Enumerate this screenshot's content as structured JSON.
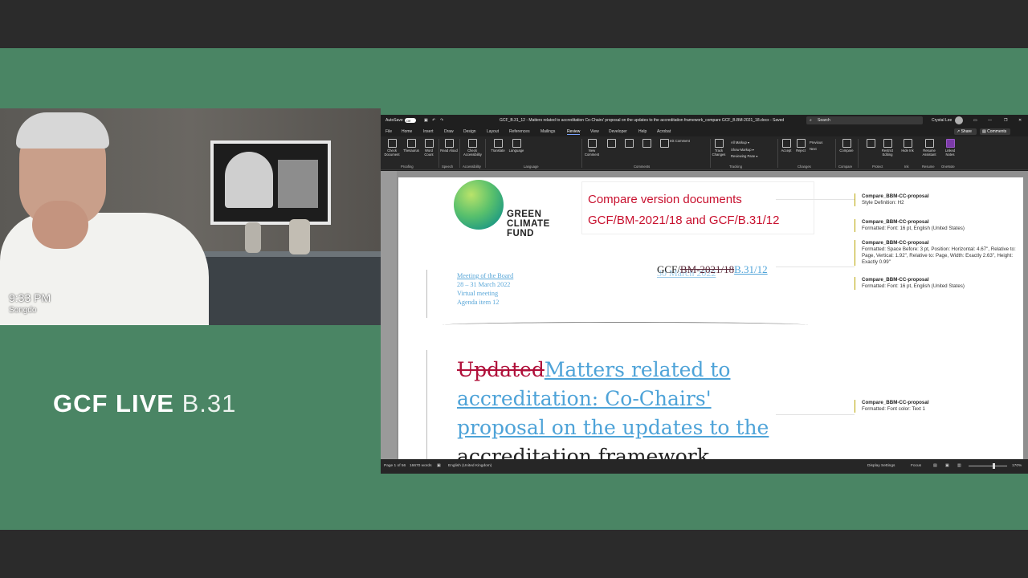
{
  "stream": {
    "time": "9:33 PM",
    "location": "Songdo",
    "brand_strong": "GCF LIVE",
    "brand_light": "B.31"
  },
  "word": {
    "autosave_label": "AutoSave",
    "autosave_state": "Off",
    "doc_title": "GCF_B.31_12 - Matters related to accreditation Co-Chairs' proposal on the updates to the accreditation framework_compare GCF_B.BM-2021_18.docx - Saved",
    "search_placeholder": "Search",
    "user_name": "Crystal Lee",
    "tabs": [
      "File",
      "Home",
      "Insert",
      "Draw",
      "Design",
      "Layout",
      "References",
      "Mailings",
      "Review",
      "View",
      "Developer",
      "Help",
      "Acrobat"
    ],
    "active_tab": "Review",
    "share_label": "Share",
    "comments_label": "Comments",
    "ribbon": {
      "check_document": "Check Document",
      "thesaurus": "Thesaurus",
      "word_count": "Word Count",
      "read_aloud": "Read Aloud",
      "check_accessibility": "Check Accessibility",
      "translate": "Translate",
      "language": "Language",
      "new_comment": "New Comment",
      "ink_comment": "Ink Comment",
      "track_changes": "Track Changes",
      "markup_select": "All Markup",
      "show_markup": "Show Markup",
      "reviewing_pane": "Reviewing Pane",
      "accept": "Accept",
      "reject": "Reject",
      "previous": "Previous",
      "next": "Next",
      "compare": "Compare",
      "restrict_editing": "Restrict Editing",
      "hide_ink": "Hide Ink",
      "resume_assistant": "Resume Assistant",
      "linked_notes": "Linked Notes",
      "groups": [
        "Proofing",
        "Speech",
        "Accessibility",
        "Language",
        "Comments",
        "Tracking",
        "Changes",
        "Compare",
        "Protect",
        "Ink",
        "Resume",
        "OneNote"
      ]
    },
    "status": {
      "page": "Page 1 of 56",
      "words": "16670 words",
      "language": "English (United Kingdom)",
      "display_settings": "Display Settings",
      "focus": "Focus",
      "zoom": "170%"
    },
    "document": {
      "logo_lines": [
        "GREEN",
        "CLIMATE",
        "FUND"
      ],
      "compare_line1": "Compare version documents",
      "compare_line2": "GCF/BM-2021/18 and GCF/B.31/12",
      "meeting_line1": "Meeting of the Board",
      "meeting_line2": "28 – 31 March 2022",
      "meeting_line3": "Virtual meeting",
      "meeting_line4": "Agenda item 12",
      "doc_prefix": "GCF/",
      "doc_deleted": "BM-2021/18",
      "doc_inserted": "B.31/12",
      "doc_underlay": "30 March 2022",
      "title_deleted": "Updated",
      "title_inserted": "Matters related to accreditation: Co-Chairs' proposal on the updates to the",
      "title_cut": "accreditation framework"
    },
    "balloons": [
      {
        "author": "Compare_BBM-CC-proposal",
        "text": "Style Definition: H2"
      },
      {
        "author": "Compare_BBM-CC-proposal",
        "text": "Formatted: Font: 16 pt, English (United States)"
      },
      {
        "author": "Compare_BBM-CC-proposal",
        "text": "Formatted: Space Before: 3 pt, Position: Horizontal: 4.67\", Relative to: Page, Vertical: 1.92\", Relative to: Page, Width: Exactly 2.63\", Height: Exactly 0.99\""
      },
      {
        "author": "Compare_BBM-CC-proposal",
        "text": "Formatted: Font: 16 pt, English (United States)"
      },
      {
        "author": "Compare_BBM-CC-proposal",
        "text": "Formatted: Font color: Text 1"
      }
    ]
  }
}
